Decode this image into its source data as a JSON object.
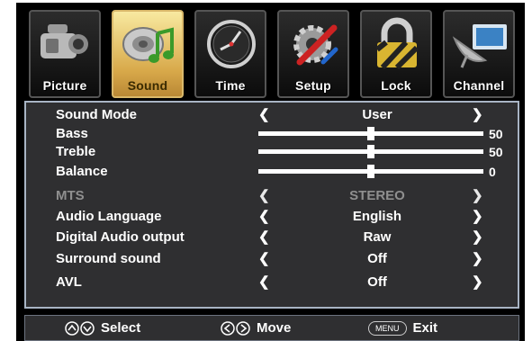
{
  "tabs": [
    {
      "label": "Picture",
      "icon": "camcorder-icon",
      "active": false
    },
    {
      "label": "Sound",
      "icon": "speaker-note-icon",
      "active": true
    },
    {
      "label": "Time",
      "icon": "clock-icon",
      "active": false
    },
    {
      "label": "Setup",
      "icon": "gear-tools-icon",
      "active": false
    },
    {
      "label": "Lock",
      "icon": "padlock-icon",
      "active": false
    },
    {
      "label": "Channel",
      "icon": "satellite-dish-icon",
      "active": false
    }
  ],
  "menu": {
    "sound_mode": {
      "label": "Sound Mode",
      "value": "User"
    },
    "bass": {
      "label": "Bass",
      "value": "50",
      "level": 0.5
    },
    "treble": {
      "label": "Treble",
      "value": "50",
      "level": 0.5
    },
    "balance": {
      "label": "Balance",
      "value": "0",
      "level": 0.5
    },
    "mts": {
      "label": "MTS",
      "value": "STEREO",
      "disabled": true
    },
    "audio_language": {
      "label": "Audio Language",
      "value": "English"
    },
    "digital_audio_output": {
      "label": "Digital Audio output",
      "value": "Raw"
    },
    "surround_sound": {
      "label": "Surround sound",
      "value": "Off"
    },
    "avl": {
      "label": "AVL",
      "value": "Off"
    }
  },
  "arrows": {
    "left": "❮",
    "right": "❯"
  },
  "footer": {
    "select_label": "Select",
    "move_label": "Move",
    "menu_key": "MENU",
    "exit_label": "Exit"
  },
  "colors": {
    "panel_bg": "#2f2f31",
    "panel_border": "#a8b4c4",
    "active_tab": "#e6c46a",
    "disabled_text": "#8f8f8f"
  }
}
